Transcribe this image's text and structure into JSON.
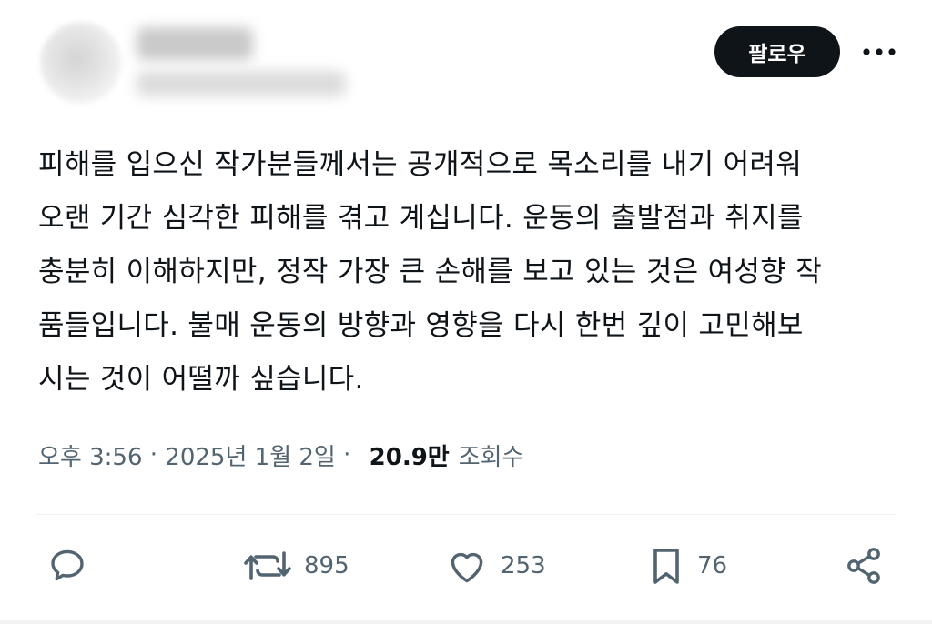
{
  "header": {
    "follow_label": "팔로우"
  },
  "tweet": {
    "lines": [
      "피해를 입으신 작가분들께서는 공개적으로 목소리를 내기 어려워",
      "오랜 기간 심각한 피해를 겪고 계십니다. 운동의 출발점과 취지를",
      "충분히 이해하지만, 정작 가장 큰 손해를 보고 있는 것은 여성향 작",
      "품들입니다. 불매 운동의 방향과 영향을 다시 한번 깊이 고민해보",
      "시는 것이 어떨까 싶습니다."
    ]
  },
  "meta": {
    "time": "오후 3:56",
    "date": "2025년 1월 2일",
    "views_count": "20.9만",
    "views_label": "조회수"
  },
  "actions": {
    "reply_icon": "speech-bubble-icon",
    "retweets": "895",
    "likes": "253",
    "bookmarks": "76",
    "share_icon": "share-nodes-icon"
  },
  "colors": {
    "text": "#0f1419",
    "muted": "#536471",
    "button_bg": "#0f1419",
    "divider": "#eff3f4"
  }
}
